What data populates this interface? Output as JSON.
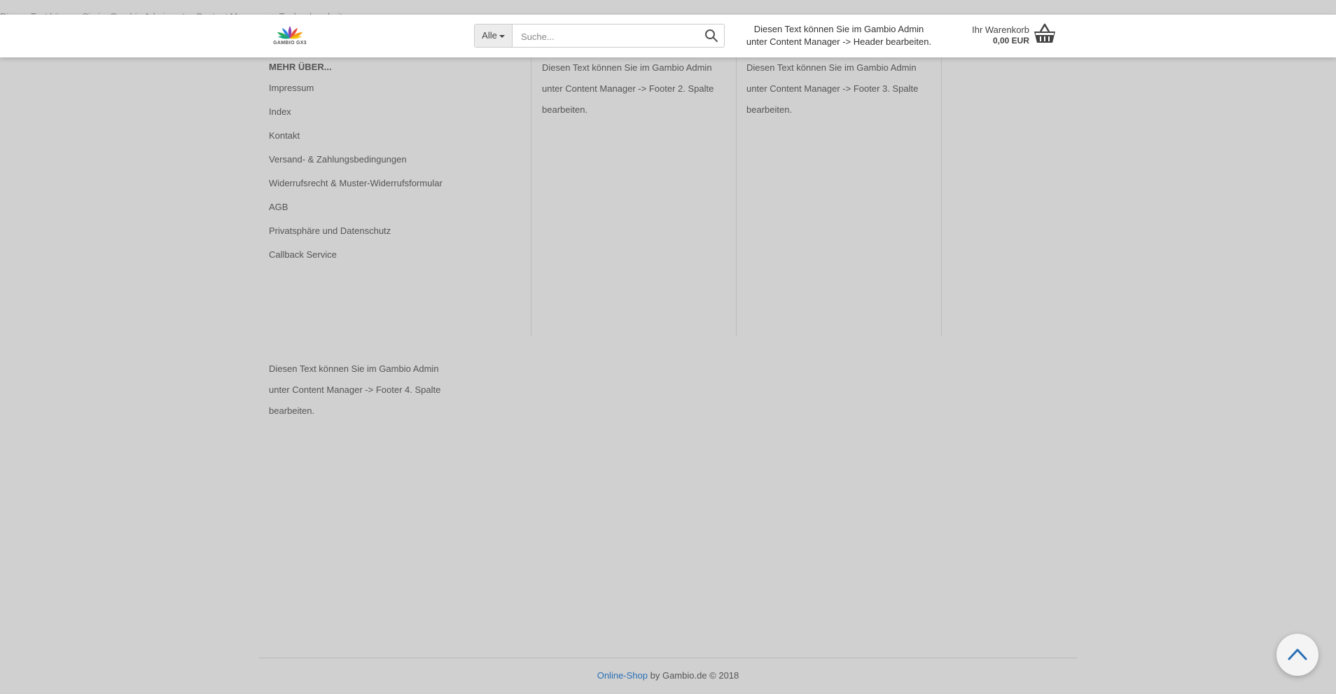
{
  "topbar": {
    "text": "Diesen Text können Sie im Gambio Admin unter Content Manager -> Topbar bearbeiten."
  },
  "header": {
    "logo_text": "GAMBIO GX3",
    "search": {
      "category": "Alle",
      "placeholder": "Suche..."
    },
    "text_line1": "Diesen Text können Sie im Gambio Admin",
    "text_line2": "unter Content Manager -> Header bearbeiten.",
    "cart": {
      "label": "Ihr Warenkorb",
      "total": "0,00 EUR"
    }
  },
  "footer": {
    "col1": {
      "title": "MEHR ÜBER...",
      "links": [
        "Impressum",
        "Index",
        "Kontakt",
        "Versand- & Zahlungsbedingungen",
        "Widerrufsrecht & Muster-Widerrufsformular",
        "AGB",
        "Privatsphäre und Datenschutz",
        "Callback Service"
      ]
    },
    "col2": {
      "text": "Diesen Text können Sie im Gambio Admin unter Content Manager -> Footer 2. Spalte bearbeiten."
    },
    "col3": {
      "text": "Diesen Text können Sie im Gambio Admin unter Content Manager -> Footer 3. Spalte bearbeiten."
    },
    "col4": {
      "text": "Diesen Text können Sie im Gambio Admin unter Content Manager -> Footer 4. Spalte bearbeiten."
    },
    "copyright": {
      "link": "Online-Shop",
      "text": " by Gambio.de © 2018"
    }
  },
  "colors": {
    "background": "#d0d0d0",
    "header_bg": "#ffffff",
    "link_blue": "#2a6fb5"
  }
}
